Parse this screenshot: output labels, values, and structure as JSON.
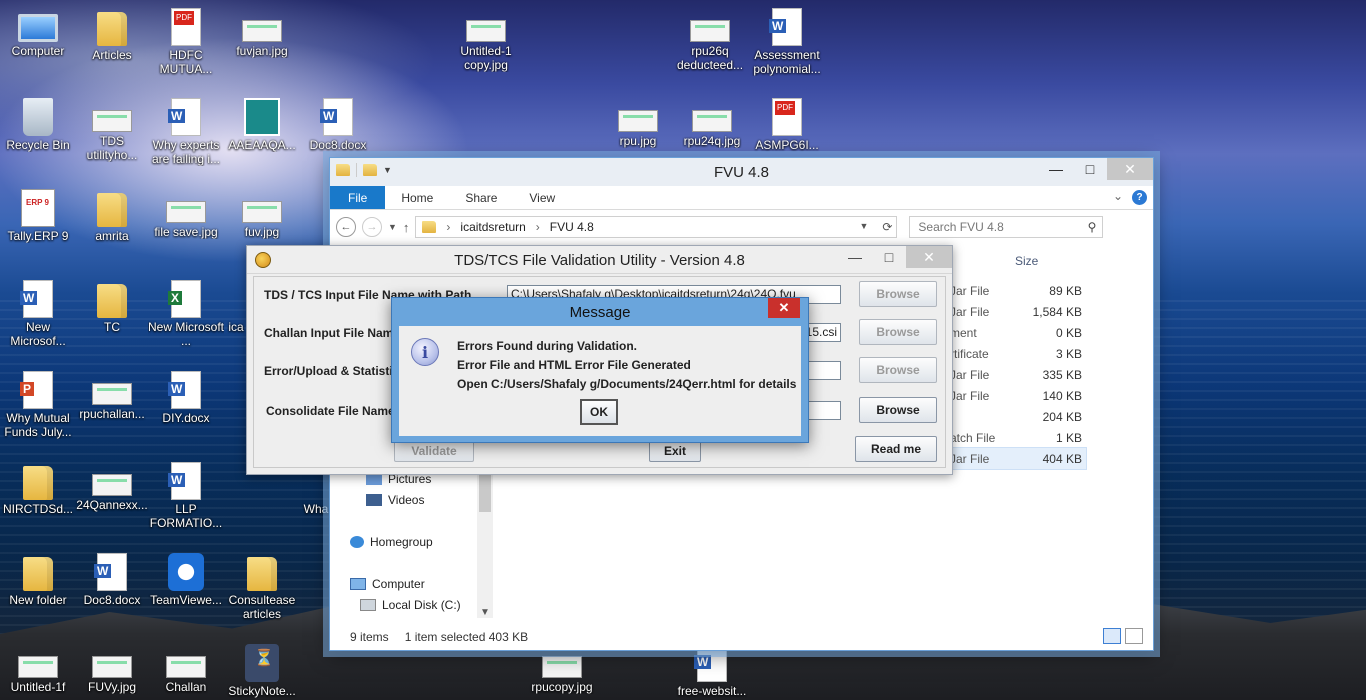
{
  "desktop": {
    "icons": [
      {
        "label": "Computer"
      },
      {
        "label": "Articles"
      },
      {
        "label": "HDFC MUTUA..."
      },
      {
        "label": "fuvjan.jpg"
      },
      {
        "label": "Untitled-1 copy.jpg"
      },
      {
        "label": "rpu26q deducteed..."
      },
      {
        "label": "Assessment polynomial..."
      },
      {
        "label": "Recycle Bin"
      },
      {
        "label": "TDS utilityho..."
      },
      {
        "label": "Why experts are failing i..."
      },
      {
        "label": "AAEAAQA..."
      },
      {
        "label": "Doc8.docx"
      },
      {
        "label": "rpu.jpg"
      },
      {
        "label": "rpu24q.jpg"
      },
      {
        "label": "ASMPG6I..."
      },
      {
        "label": "Tally.ERP 9"
      },
      {
        "label": "amrita"
      },
      {
        "label": "file save.jpg"
      },
      {
        "label": "fuv.jpg"
      },
      {
        "label": "New Microsof..."
      },
      {
        "label": "TC"
      },
      {
        "label": "New Microsoft ..."
      },
      {
        "label": "ica"
      },
      {
        "label": "Why Mutual Funds July..."
      },
      {
        "label": "rpuchallan..."
      },
      {
        "label": "DIY.docx"
      },
      {
        "label": "NIRCTDSd..."
      },
      {
        "label": "24Qannexx..."
      },
      {
        "label": "LLP FORMATIO..."
      },
      {
        "label": "Wha"
      },
      {
        "label": "New folder"
      },
      {
        "label": "Doc8.docx"
      },
      {
        "label": "TeamViewe..."
      },
      {
        "label": "Consultease articles"
      },
      {
        "label": "Untitled-1f"
      },
      {
        "label": "FUVy.jpg"
      },
      {
        "label": "Challan"
      },
      {
        "label": "StickyNote..."
      },
      {
        "label": "rpucopy.jpg"
      },
      {
        "label": "free-websit..."
      }
    ]
  },
  "explorer": {
    "title": "FVU 4.8",
    "ribbon_tabs": [
      "File",
      "Home",
      "Share",
      "View"
    ],
    "breadcrumb": [
      "icaitdsreturn",
      "FVU 4.8"
    ],
    "search_placeholder": "Search FVU 4.8",
    "size_header": "Size",
    "files": [
      {
        "name": "Jar File",
        "size": "89 KB"
      },
      {
        "name": "Jar File",
        "size": "1,584 KB"
      },
      {
        "name": "ment",
        "size": "0 KB"
      },
      {
        "name": "rtificate",
        "size": "3 KB"
      },
      {
        "name": "Jar File",
        "size": "335 KB"
      },
      {
        "name": "Jar File",
        "size": "140 KB"
      },
      {
        "name": "",
        "size": "204 KB"
      },
      {
        "name": "atch File",
        "size": "1 KB"
      },
      {
        "name": "Jar File",
        "size": "404 KB"
      }
    ],
    "nav_items": [
      "Pictures",
      "Videos",
      "Homegroup",
      "Computer",
      "Local Disk (C:)"
    ],
    "status": {
      "items": "9 items",
      "selected": "1 item selected  403 KB"
    }
  },
  "fvu": {
    "title": "TDS/TCS File Validation Utility - Version 4.8",
    "labels": {
      "input_file": "TDS / TCS Input File Name with Path",
      "challan_file": "Challan Input File Name",
      "error_upload": "Error/Upload & Statistic",
      "consolidate": "Consolidate File Name"
    },
    "input_file_value": "C:\\Users\\Shafaly g\\Desktop\\icaitdsreturn\\24q\\24Q.fvu",
    "challan_file_value": "15.csi",
    "buttons": {
      "browse": "Browse",
      "validate": "Validate",
      "exit": "Exit",
      "read_me": "Read me"
    }
  },
  "message": {
    "title": "Message",
    "line1": "Errors Found during Validation.",
    "line2": "Error File and HTML Error File Generated",
    "line3": "Open C:/Users/Shafaly g/Documents/24Qerr.html for details",
    "ok": "OK"
  }
}
